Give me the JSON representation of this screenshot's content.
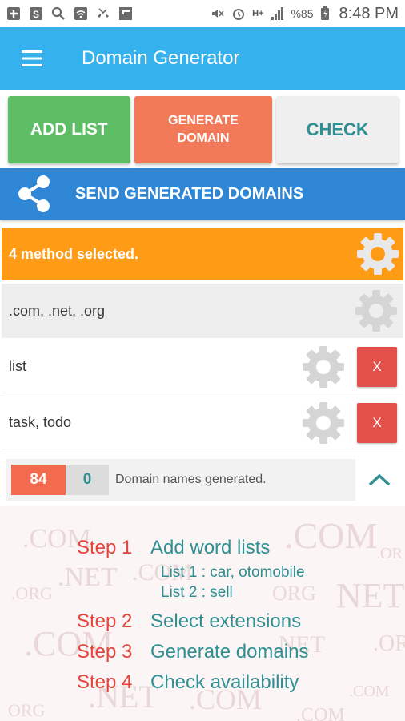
{
  "status_bar": {
    "battery": "%85",
    "time": "8:48 PM",
    "network": "H+"
  },
  "app_bar": {
    "title": "Domain Generator",
    "menu_icon": "hamburger-menu-icon"
  },
  "top_buttons": {
    "add_list": "ADD LIST",
    "generate_line1": "GENERATE",
    "generate_line2": "DOMAIN",
    "check": "CHECK"
  },
  "send_bar": {
    "label": "SEND GENERATED DOMAINS",
    "icon": "share-icon"
  },
  "method_row": {
    "label": "4 method selected."
  },
  "extensions_row": {
    "label": ".com, .net, .org"
  },
  "lists": [
    {
      "label": "list",
      "remove": "X"
    },
    {
      "label": "task, todo",
      "remove": "X"
    }
  ],
  "counts": {
    "generated": "84",
    "checked": "0",
    "label": "Domain names generated."
  },
  "steps": [
    {
      "num": "Step 1",
      "text": "Add word lists"
    },
    {
      "num": "Step 2",
      "text": "Select extensions"
    },
    {
      "num": "Step 3",
      "text": "Generate domains"
    },
    {
      "num": "Step 4",
      "text": "Check availability"
    }
  ],
  "step1_subs": [
    "List 1 : car, otomobile",
    "List 2 : sell"
  ],
  "colors": {
    "app_bar": "#35b1ee",
    "add_list": "#5dbd64",
    "generate": "#f37a58",
    "send_bar": "#2f86d4",
    "method_row": "#ff9b14",
    "remove": "#e2504a",
    "step_num": "#e2453b",
    "step_text": "#2f8f92"
  }
}
